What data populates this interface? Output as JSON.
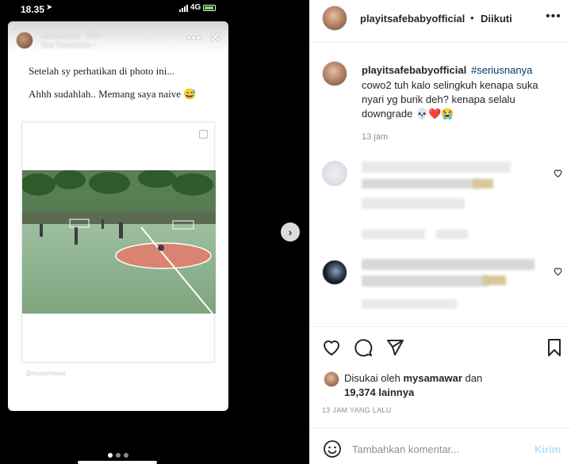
{
  "status_bar": {
    "time": "18.35",
    "network": "4G"
  },
  "story": {
    "username": "mysamawar",
    "time_ago": "20h",
    "translate_label": "See Translation",
    "line1": "Setelah sy perhatikan di photo ini...",
    "line2": "Ahhh sudahlah.. Memang saya naive 😅",
    "watermark": "@mysamawar"
  },
  "post": {
    "header": {
      "username": "playitsafebabyofficial",
      "separator": "•",
      "follow_label": "Diikuti"
    },
    "caption": {
      "username": "playitsafebabyofficial",
      "hashtag": "#seriusnanya",
      "text": "cowo2 tuh kalo selingkuh kenapa suka nyari yg burik deh? kenapa selalu downgrade 💀❤️😭",
      "time": "13 jam"
    },
    "likes": {
      "line1_prefix": "Disukai oleh ",
      "line1_user": "mysamawar",
      "line1_suffix": " dan",
      "line2": "19,374 lainnya"
    },
    "posted_ago": "13 JAM YANG LALU",
    "comment": {
      "placeholder": "Tambahkan komentar...",
      "send_label": "Kirim"
    }
  },
  "icons": {
    "heart": "heart-icon",
    "comment": "comment-icon",
    "share": "send-icon",
    "save": "bookmark-icon",
    "emoji": "emoji-icon",
    "close": "close-icon",
    "more": "more-icon",
    "next": "chevron-right-icon"
  },
  "colors": {
    "link": "#00376b",
    "send_disabled": "#b2dffc",
    "text": "#262626",
    "muted": "#8e8e8e"
  }
}
